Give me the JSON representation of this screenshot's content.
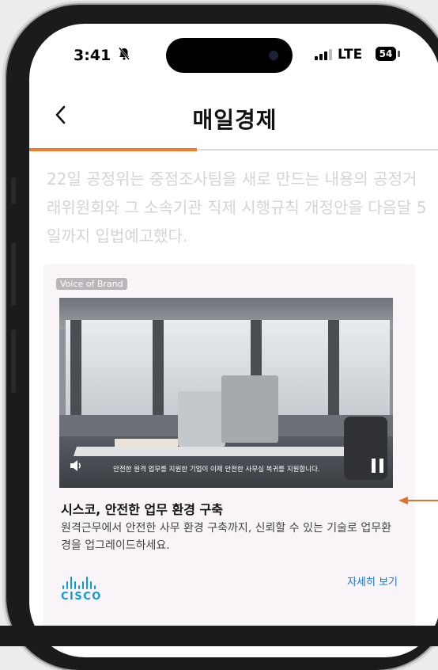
{
  "status_bar": {
    "time": "3:41",
    "mute_icon": "bell-slash-icon",
    "network": "LTE",
    "battery": "54"
  },
  "header": {
    "back_icon": "chevron-left-icon",
    "title": "매일경제"
  },
  "article": {
    "text": "22일 공정위는 중점조사팀을 새로 만드는 내용의 공정거래위원회와 그 소속기관 직제 시행규칙 개정안을 다음달 5일까지 입법예고했다."
  },
  "ad": {
    "label": "Voice of Brand",
    "video_caption": "안전한 원격 업무를 지원한 기업이 이제 안전한 사무실 복귀를 지원합니다.",
    "title": "시스코, 안전한 업무 환경 구축",
    "description": "원격근무에서 안전한 사무 환경 구축까지, 신뢰할 수 있는 기술로 업무환경을 업그레이드하세요.",
    "more_link": "자세히 보기",
    "brand": "CISCO",
    "brand_logo": "cisco-logo",
    "accent_color": "#ef7d2d",
    "link_color": "#1673d8"
  }
}
